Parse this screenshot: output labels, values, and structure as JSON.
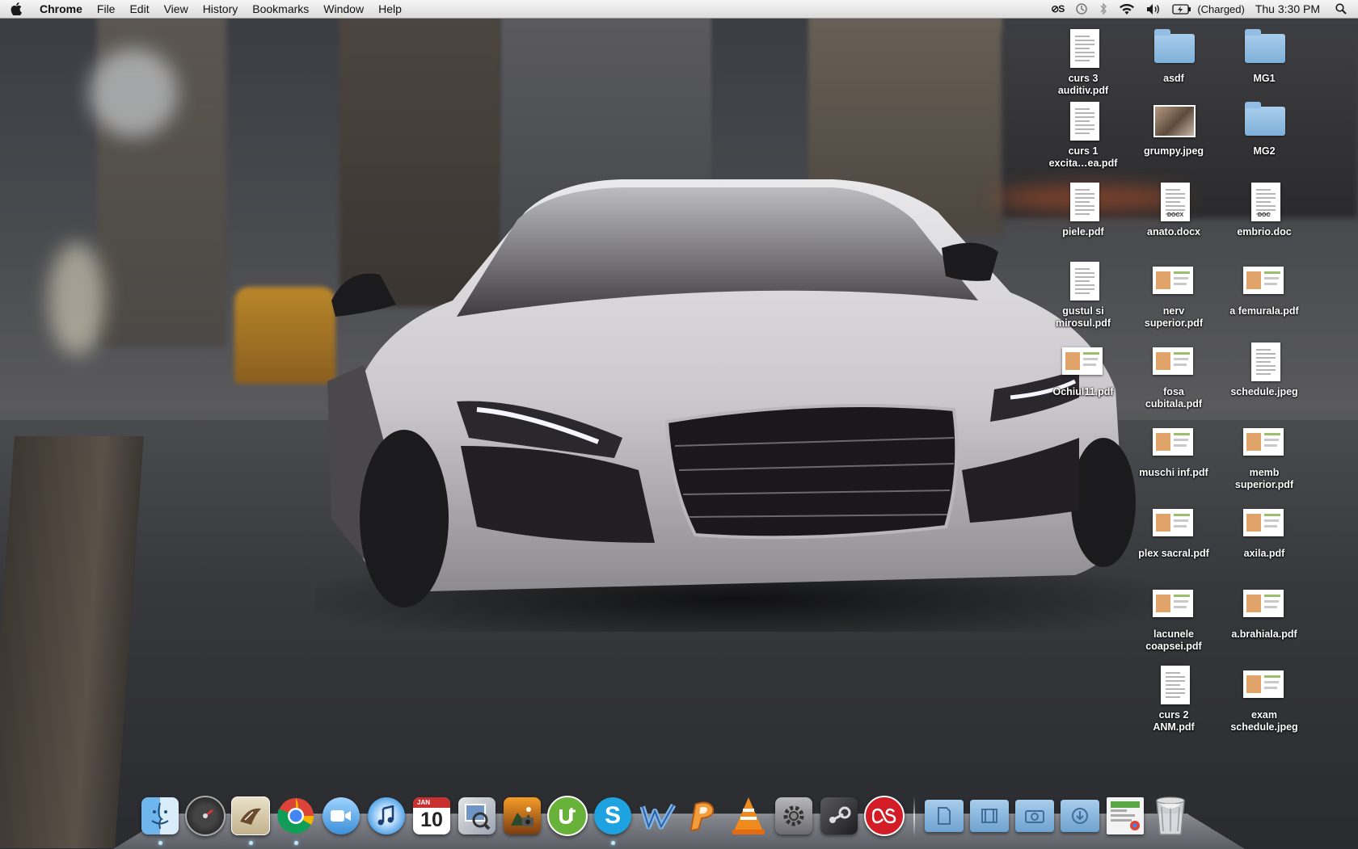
{
  "menubar": {
    "app_name": "Chrome",
    "menus": [
      "File",
      "Edit",
      "View",
      "History",
      "Bookmarks",
      "Window",
      "Help"
    ],
    "status": {
      "lastpass_label": "⊘S",
      "battery_text": "(Charged)",
      "clock": "Thu 3:30 PM"
    }
  },
  "desktop": {
    "icons": [
      {
        "name": "desktop-icon-curs3",
        "label": "curs 3\nauditiv.pdf",
        "kind": "doc"
      },
      {
        "name": "desktop-icon-asdf",
        "label": "asdf",
        "kind": "folder"
      },
      {
        "name": "desktop-icon-mg1",
        "label": "MG1",
        "kind": "folder"
      },
      {
        "name": "desktop-icon-curs1",
        "label": "curs 1\nexcita…ea.pdf",
        "kind": "doc"
      },
      {
        "name": "desktop-icon-grumpy",
        "label": "grumpy.jpeg",
        "kind": "photo"
      },
      {
        "name": "desktop-icon-mg2",
        "label": "MG2",
        "kind": "folder"
      },
      {
        "name": "desktop-icon-piele",
        "label": "piele.pdf",
        "kind": "doc"
      },
      {
        "name": "desktop-icon-anato",
        "label": "anato.docx",
        "kind": "docx",
        "tag": "DOCX"
      },
      {
        "name": "desktop-icon-embrio",
        "label": "embrio.doc",
        "kind": "docx",
        "tag": "DOC"
      },
      {
        "name": "desktop-icon-gustul",
        "label": "gustul si\nmirosul.pdf",
        "kind": "doc"
      },
      {
        "name": "desktop-icon-nerv",
        "label": "nerv\nsuperior.pdf",
        "kind": "slide"
      },
      {
        "name": "desktop-icon-femurala",
        "label": "a femurala.pdf",
        "kind": "slide"
      },
      {
        "name": "desktop-icon-ochiul",
        "label": "Ochiul11.pdf",
        "kind": "slide"
      },
      {
        "name": "desktop-icon-fosa",
        "label": "fosa\ncubitala.pdf",
        "kind": "slide"
      },
      {
        "name": "desktop-icon-schedule",
        "label": "schedule.jpeg",
        "kind": "doc"
      },
      {
        "name": "desktop-icon-muschi",
        "label": "muschi inf.pdf",
        "kind": "slide"
      },
      {
        "name": "desktop-icon-memb",
        "label": "memb\nsuperior.pdf",
        "kind": "slide"
      },
      {
        "name": "desktop-icon-plex",
        "label": "plex sacral.pdf",
        "kind": "slide"
      },
      {
        "name": "desktop-icon-axila",
        "label": "axila.pdf",
        "kind": "slide"
      },
      {
        "name": "desktop-icon-lacunele",
        "label": "lacunele\ncoapsei.pdf",
        "kind": "slide"
      },
      {
        "name": "desktop-icon-brahiala",
        "label": "a.brahiala.pdf",
        "kind": "slide"
      },
      {
        "name": "desktop-icon-curs2",
        "label": "curs 2\nANM.pdf",
        "kind": "doc"
      },
      {
        "name": "desktop-icon-exam",
        "label": "exam\nschedule.jpeg",
        "kind": "slide"
      }
    ]
  },
  "dock": {
    "calendar": {
      "month": "JAN",
      "day": "10"
    },
    "apps": [
      "finder-icon",
      "dashboard-icon",
      "mail-icon",
      "chrome-icon",
      "facetime-icon",
      "itunes-icon",
      "calendar-icon",
      "preview-icon",
      "iphoto-icon",
      "utorrent-icon",
      "skype-icon",
      "word-icon",
      "powerpoint-icon",
      "vlc-icon",
      "system-preferences-icon",
      "steam-icon",
      "lastfm-icon"
    ],
    "stacks": [
      "documents-stack-icon",
      "movies-stack-icon",
      "pictures-stack-icon",
      "downloads-stack-icon",
      "recent-stack-icon",
      "trash-icon"
    ]
  },
  "colors": {
    "folder": "#7eb0d9",
    "chrome_red": "#db4437",
    "utorrent_green": "#69b23a",
    "skype_blue": "#1fa3e0"
  }
}
